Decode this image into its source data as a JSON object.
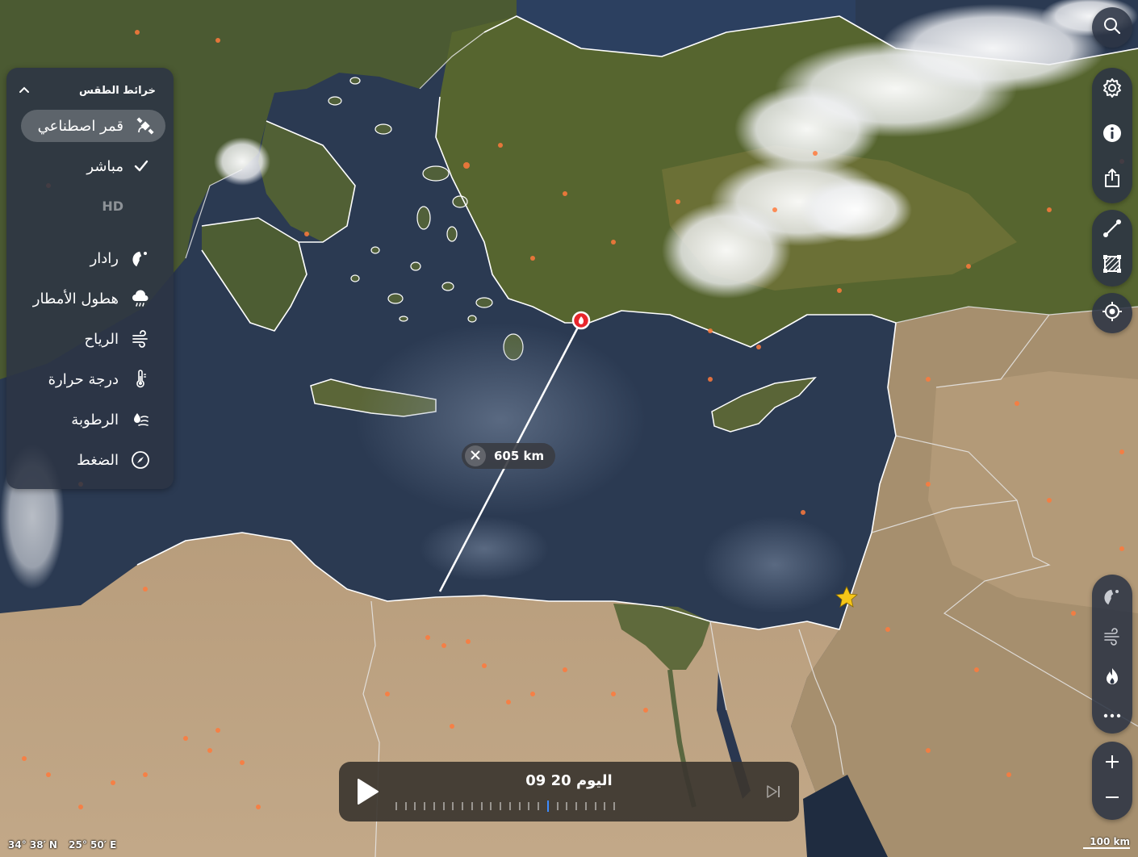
{
  "panel": {
    "title": "خرائط الطقس",
    "items": [
      {
        "label": "قمر اصطناعي",
        "icon": "satellite-icon",
        "selected": true
      },
      {
        "label": "مباشر",
        "icon": "checkmark-icon",
        "sub": true,
        "checked": true
      },
      {
        "label": "HD",
        "sub": true,
        "disabled": true
      },
      {
        "label": "رادار",
        "icon": "radar-icon"
      },
      {
        "label": "هطول الأمطار",
        "icon": "rain-cloud-icon"
      },
      {
        "label": "الرياح",
        "icon": "wind-icon"
      },
      {
        "label": "درجة حرارة",
        "icon": "thermometer-icon"
      },
      {
        "label": "الرطوبة",
        "icon": "humidity-icon"
      },
      {
        "label": "الضغط",
        "icon": "pressure-gauge-icon"
      }
    ]
  },
  "measurement": {
    "distance": "605 km"
  },
  "player": {
    "time_label": "اليوم 20  09",
    "progress_fraction": 0.69
  },
  "status": {
    "lat": "34° 38′ N",
    "lon": "25° 50′ E",
    "scale": "100 km"
  },
  "colors": {
    "sea": "#2b3a52",
    "land": "#4a5a2c",
    "desert": "#b89d7c",
    "cloud": "#f2f3f5",
    "fire": "#ff7a3c",
    "accent": "#3d8bff",
    "marker": "#e8262c",
    "star": "#f5c518"
  }
}
